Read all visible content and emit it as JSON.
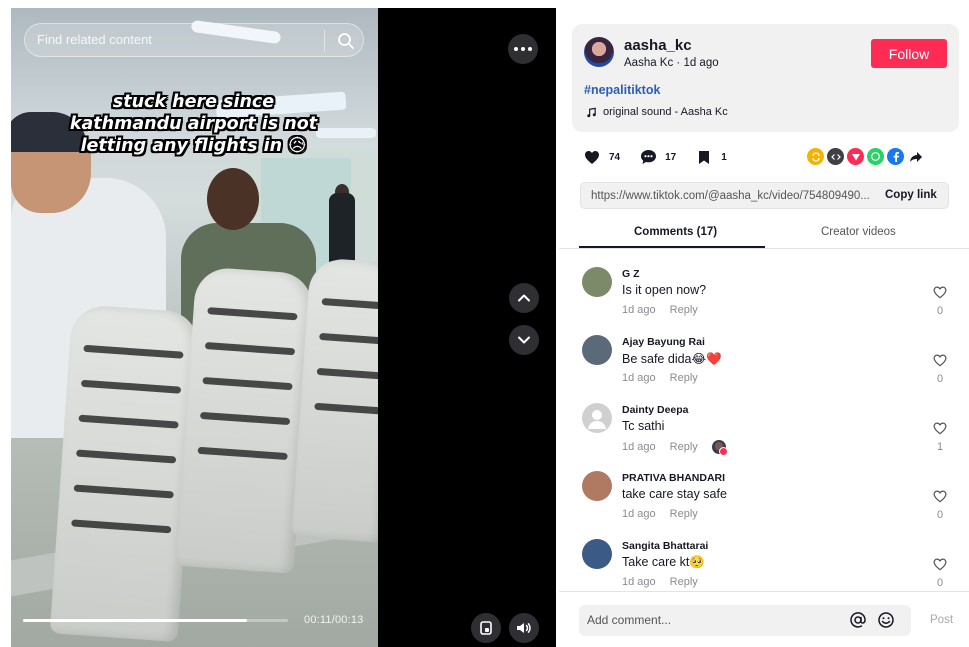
{
  "video": {
    "search_placeholder": "Find related content",
    "caption_lines": [
      "stuck here since",
      "kathmandu airport is not",
      "letting any flights in 😥"
    ],
    "time_readout": "00:11/00:13",
    "progress_fraction": 0.846
  },
  "post": {
    "username": "aasha_kc",
    "display_line": "Aasha Kc · 1d ago",
    "follow_label": "Follow",
    "hashtag": "#nepalitiktok",
    "sound": "original sound - Aasha Kc",
    "likes": "74",
    "comments": "17",
    "saves": "1",
    "link": "https://www.tiktok.com/@aasha_kc/video/754809490...",
    "copy_link_label": "Copy link"
  },
  "tabs": {
    "comments": "Comments (17)",
    "creator_videos": "Creator videos"
  },
  "comments": [
    {
      "name": "G Z",
      "text": "Is it open now?",
      "time": "1d ago",
      "reply": "Reply",
      "likes": "0",
      "avatar_color": "#7c8a6a"
    },
    {
      "name": "Ajay Bayung Rai",
      "text": "Be safe dida😂❤️",
      "time": "1d ago",
      "reply": "Reply",
      "likes": "0",
      "avatar_color": "#5a6a78"
    },
    {
      "name": "Dainty Deepa",
      "text": "Tc sathi",
      "time": "1d ago",
      "reply": "Reply",
      "likes": "1",
      "avatar_color": "#d0d0d3",
      "creator_liked": true
    },
    {
      "name": "PRATIVA BHANDARI",
      "text": "take care stay safe",
      "time": "1d ago",
      "reply": "Reply",
      "likes": "0",
      "avatar_color": "#b07a62"
    },
    {
      "name": "Sangita Bhattarai",
      "text": "Take care kt🥺",
      "time": "1d ago",
      "reply": "Reply",
      "likes": "0",
      "avatar_color": "#3c5a86"
    }
  ],
  "footer": {
    "comment_placeholder": "Add comment...",
    "post_label": "Post"
  },
  "colors": {
    "accent": "#fe2c55",
    "hashtag": "#2b5db9"
  },
  "share_icons": [
    "repost-icon",
    "embed-icon",
    "send-icon",
    "whatsapp-icon",
    "facebook-icon",
    "share-arrow-icon"
  ]
}
